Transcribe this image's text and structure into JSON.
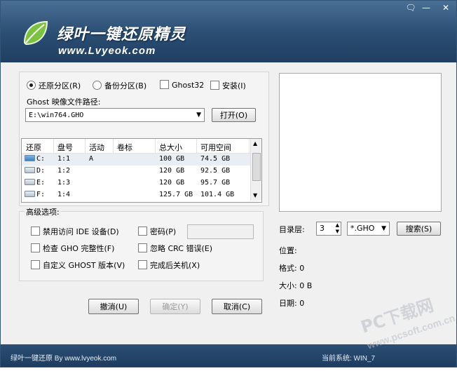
{
  "header": {
    "title": "绿叶一键还原精灵",
    "website": "www.Lvyeok.com"
  },
  "mode": {
    "restore_label": "还原分区(R)",
    "backup_label": "备份分区(B)",
    "ghost32_label": "Ghost32",
    "install_label": "安装(I)"
  },
  "path": {
    "label": "Ghost 映像文件路径:",
    "value": "E:\\win764.GHO",
    "open_button": "打开(O)"
  },
  "table": {
    "headers": [
      "还原",
      "盘号",
      "活动",
      "卷标",
      "总大小",
      "可用空间"
    ],
    "rows": [
      {
        "drive": "C:",
        "disk": "1:1",
        "active": "A",
        "label": "",
        "total": "100 GB",
        "free": "74.5 GB"
      },
      {
        "drive": "D:",
        "disk": "1:2",
        "active": "",
        "label": "",
        "total": "120 GB",
        "free": "92.5 GB"
      },
      {
        "drive": "E:",
        "disk": "1:3",
        "active": "",
        "label": "",
        "total": "120 GB",
        "free": "95.7 GB"
      },
      {
        "drive": "F:",
        "disk": "1:4",
        "active": "",
        "label": "",
        "total": "125.7 GB",
        "free": "101.4 GB"
      }
    ]
  },
  "advanced": {
    "title": "高级选项:",
    "disable_ide": "禁用访问 IDE 设备(D)",
    "check_gho": "检查 GHO 完整性(F)",
    "custom_ghost": "自定义 GHOST 版本(V)",
    "password": "密码(P)",
    "ignore_crc": "忽略 CRC 错误(E)",
    "shutdown": "完成后关机(X)"
  },
  "buttons": {
    "undo": "撤消(U)",
    "ok": "确定(Y)",
    "cancel": "取消(C)"
  },
  "search": {
    "dir_level_label": "目录层:",
    "dir_level_value": "3",
    "ext_value": "*.GHO",
    "search_button": "搜索(S)"
  },
  "info": {
    "location": "位置:",
    "format": "格式: 0",
    "size": "大小: 0 B",
    "date": "日期: 0"
  },
  "footer": {
    "left": "绿叶一键还原 By www.lvyeok.com",
    "right": "当前系统: WIN_7"
  },
  "watermark": {
    "line1": "PC下载网",
    "line2": "www.pcsoft.com.cn"
  }
}
